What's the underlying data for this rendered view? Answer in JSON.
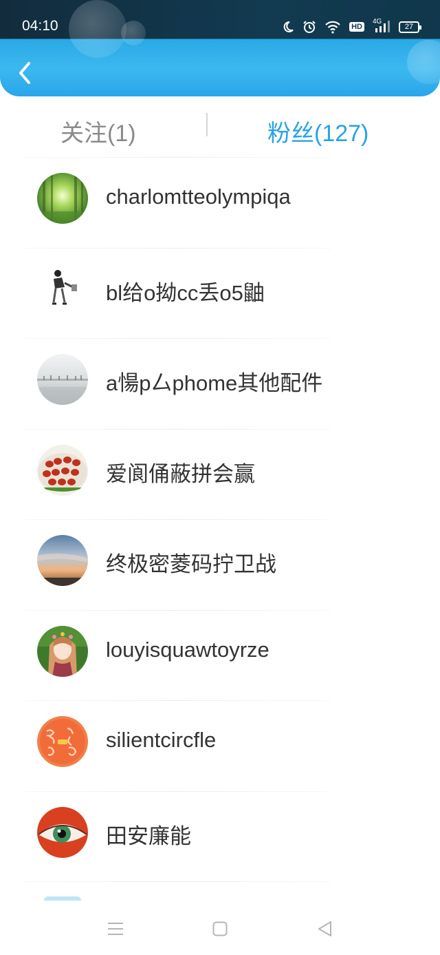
{
  "status_bar": {
    "time": "04:10",
    "icons": [
      "moon-icon",
      "alarm-icon",
      "wifi-icon",
      "hd-icon",
      "signal-4g-icon",
      "battery-icon"
    ],
    "hd_label": "HD",
    "network_label": "4G",
    "battery_level": "27"
  },
  "header": {
    "back_icon": "chevron-left-icon",
    "colors": {
      "gradient_start": "#2aa9e6",
      "gradient_end": "#29a6ea"
    }
  },
  "tabs": [
    {
      "label": "关注(1)",
      "active": false
    },
    {
      "label": "粉丝(127)",
      "active": true
    }
  ],
  "colors": {
    "active_tab": "#2aa2e4",
    "inactive_tab": "#8a8a8a"
  },
  "fans": [
    {
      "name": "charlomtteolympiqa",
      "avatar": "forest-avatar"
    },
    {
      "name": "bl给o拗cc丢o5鼬",
      "avatar": "sketch-figure-avatar"
    },
    {
      "name": "a愓p厶phome其他配件",
      "avatar": "misty-sea-avatar"
    },
    {
      "name": "爱阆俑蔽拼会赢",
      "avatar": "food-skewers-avatar"
    },
    {
      "name": "终极密菱码拧卫战",
      "avatar": "sunset-sky-avatar"
    },
    {
      "name": "louyisquawtoyrze",
      "avatar": "anime-girl-avatar"
    },
    {
      "name": "silientcircfle",
      "avatar": "orange-badge-avatar"
    },
    {
      "name": "田安廉能",
      "avatar": "eye-avatar"
    }
  ],
  "nav": [
    "menu-icon",
    "home-square-icon",
    "back-triangle-icon"
  ]
}
